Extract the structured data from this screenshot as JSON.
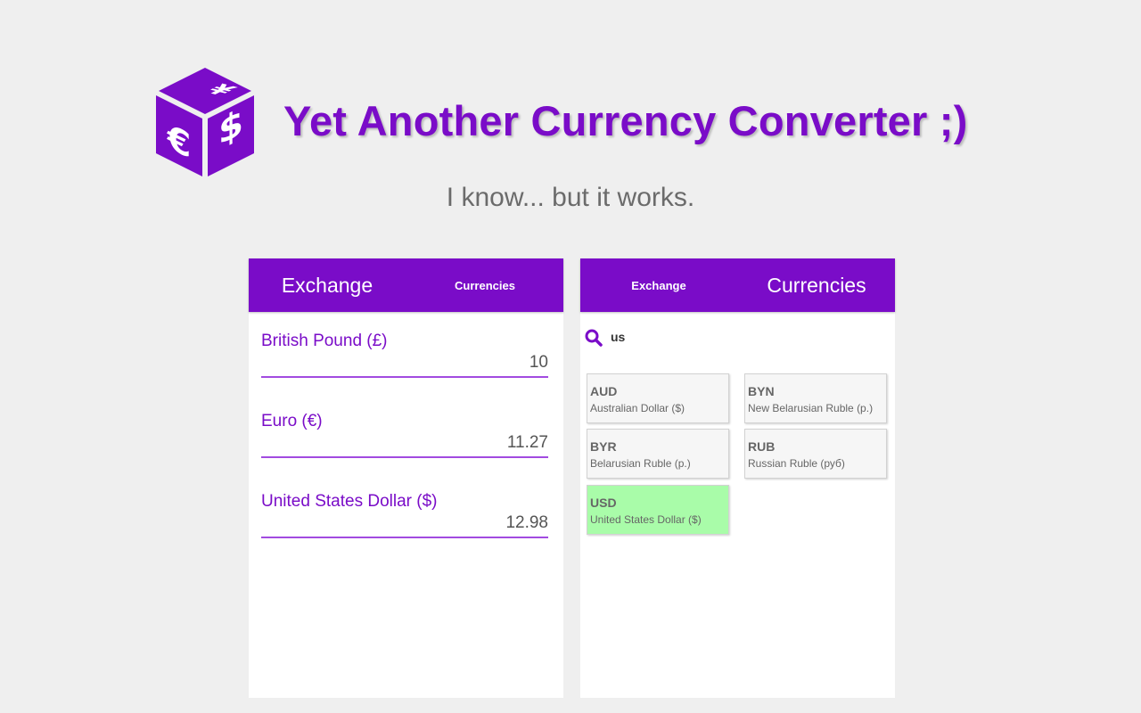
{
  "header": {
    "title": "Yet Another Currency Converter ;)",
    "tagline": "I know... but it works.",
    "logo_icon": "currency-dice-icon",
    "logo_glyphs": {
      "yen": "¥",
      "euro": "€",
      "dollar": "$"
    }
  },
  "colors": {
    "accent": "#7a0cc8",
    "background": "#efefef",
    "selected_card": "#a9fca9",
    "card": "#f6f6f6"
  },
  "exchange_panel": {
    "tabs": {
      "exchange": "Exchange",
      "currencies": "Currencies",
      "active": "exchange"
    },
    "fields": [
      {
        "label": "British Pound (£)",
        "value": "10"
      },
      {
        "label": "Euro (€)",
        "value": "11.27"
      },
      {
        "label": "United States Dollar ($)",
        "value": "12.98"
      }
    ]
  },
  "currencies_panel": {
    "tabs": {
      "exchange": "Exchange",
      "currencies": "Currencies",
      "active": "currencies"
    },
    "search": {
      "icon": "search-icon",
      "value": "us"
    },
    "cards": [
      {
        "code": "AUD",
        "name": "Australian Dollar ($)",
        "selected": false
      },
      {
        "code": "BYN",
        "name": "New Belarusian Ruble (p.)",
        "selected": false
      },
      {
        "code": "BYR",
        "name": "Belarusian Ruble (p.)",
        "selected": false
      },
      {
        "code": "RUB",
        "name": "Russian Ruble (руб)",
        "selected": false
      },
      {
        "code": "USD",
        "name": "United States Dollar ($)",
        "selected": true
      }
    ]
  }
}
